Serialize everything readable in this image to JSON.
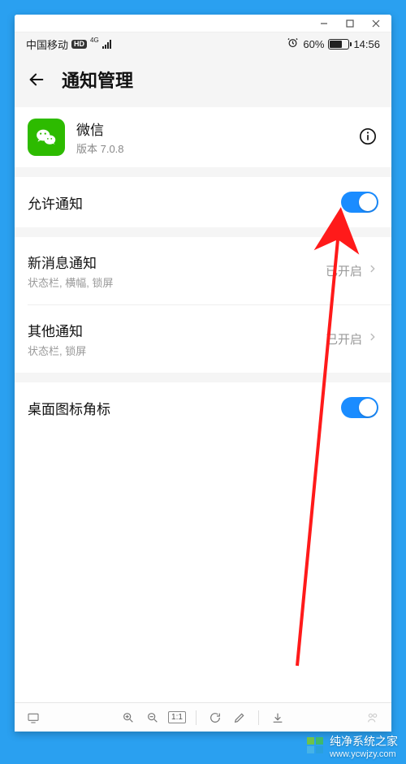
{
  "status_bar": {
    "carrier": "中国移动",
    "hd_label": "HD",
    "network_label": "4G",
    "battery_percent": "60%",
    "time": "14:56"
  },
  "header": {
    "title": "通知管理"
  },
  "app": {
    "name": "微信",
    "version_label": "版本 7.0.8"
  },
  "rows": {
    "allow_notifications": {
      "title": "允许通知",
      "enabled": true
    },
    "new_message": {
      "title": "新消息通知",
      "sub": "状态栏, 横幅, 锁屏",
      "value": "已开启"
    },
    "other": {
      "title": "其他通知",
      "sub": "状态栏, 锁屏",
      "value": "已开启"
    },
    "badge": {
      "title": "桌面图标角标",
      "enabled": true
    }
  },
  "toolbar": {
    "one_to_one": "1:1"
  },
  "watermark": {
    "brand": "纯净系统之家",
    "url": "www.ycwjzy.com"
  }
}
